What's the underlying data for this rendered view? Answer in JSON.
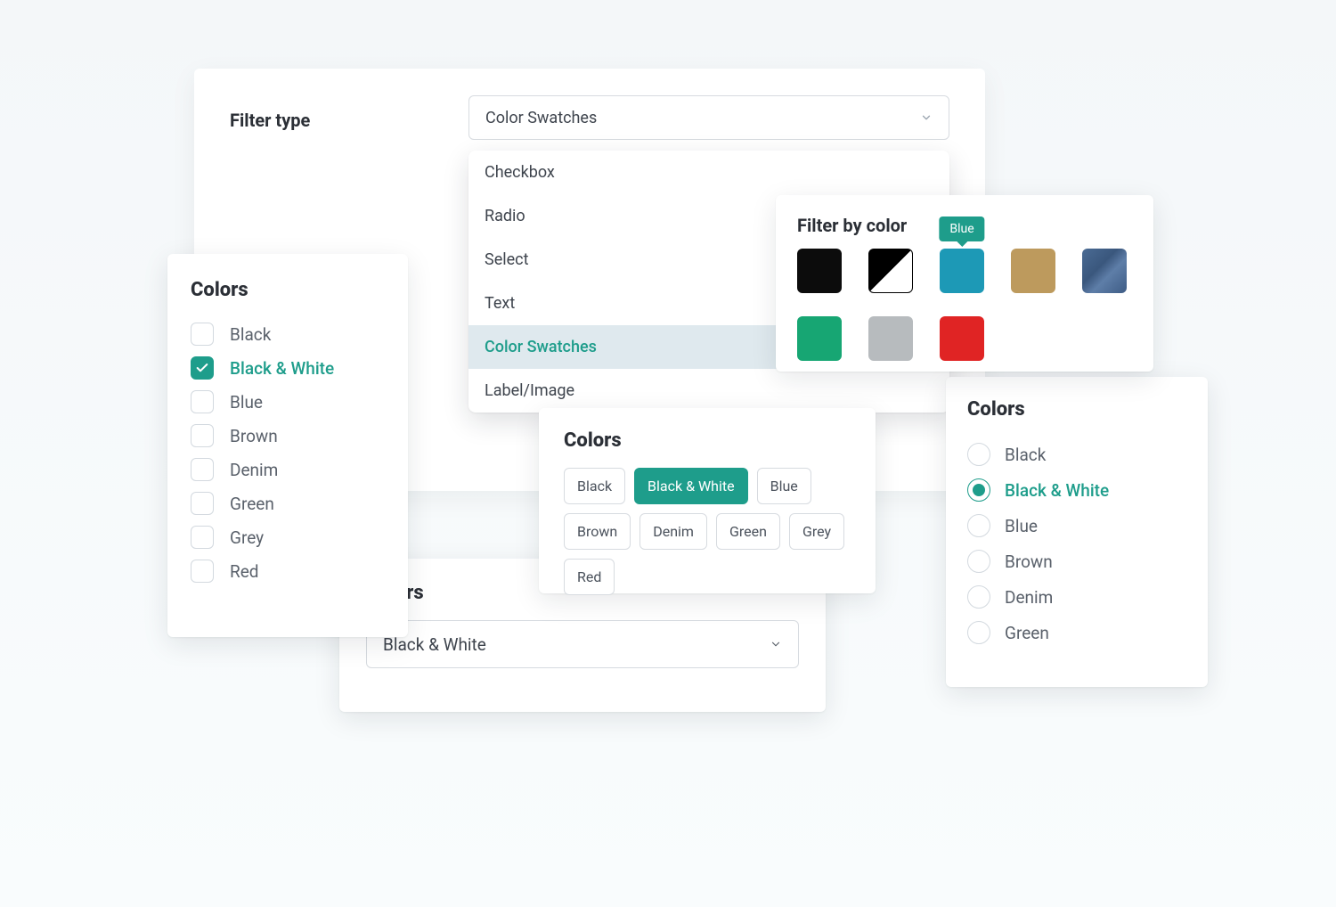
{
  "settings": {
    "label": "Filter type",
    "selected": "Color Swatches",
    "options": [
      "Checkbox",
      "Radio",
      "Select",
      "Text",
      "Color Swatches",
      "Label/Image"
    ],
    "highlighted_index": 4
  },
  "checkbox_panel": {
    "title": "Colors",
    "items": [
      {
        "label": "Black",
        "checked": false
      },
      {
        "label": "Black & White",
        "checked": true
      },
      {
        "label": "Blue",
        "checked": false
      },
      {
        "label": "Brown",
        "checked": false
      },
      {
        "label": "Denim",
        "checked": false
      },
      {
        "label": "Green",
        "checked": false
      },
      {
        "label": "Grey",
        "checked": false
      },
      {
        "label": "Red",
        "checked": false
      }
    ]
  },
  "swatch_panel": {
    "title": "Filter by color",
    "tooltip": "Blue",
    "swatches": [
      {
        "name": "Black",
        "color": "#0c0c0c",
        "row": 0,
        "tooltip": false
      },
      {
        "name": "Black & White",
        "split": true,
        "row": 0,
        "tooltip": false
      },
      {
        "name": "Blue",
        "color": "#1d99b6",
        "row": 0,
        "tooltip": true
      },
      {
        "name": "Brown",
        "color": "#bd9a5d",
        "row": 0,
        "tooltip": false
      },
      {
        "name": "Denim",
        "denim": true,
        "row": 0,
        "tooltip": false
      },
      {
        "name": "Green",
        "color": "#17a673",
        "row": 1,
        "tooltip": false
      },
      {
        "name": "Grey",
        "color": "#b7bbbe",
        "row": 1,
        "tooltip": false
      },
      {
        "name": "Red",
        "color": "#e02424",
        "row": 1,
        "tooltip": false
      }
    ]
  },
  "chips_panel": {
    "title": "Colors",
    "items": [
      {
        "label": "Black",
        "active": false
      },
      {
        "label": "Black & White",
        "active": true
      },
      {
        "label": "Blue",
        "active": false
      },
      {
        "label": "Brown",
        "active": false
      },
      {
        "label": "Denim",
        "active": false
      },
      {
        "label": "Green",
        "active": false
      },
      {
        "label": "Grey",
        "active": false
      },
      {
        "label": "Red",
        "active": false
      }
    ]
  },
  "radio_panel": {
    "title": "Colors",
    "items": [
      {
        "label": "Black",
        "checked": false
      },
      {
        "label": "Black & White",
        "checked": true
      },
      {
        "label": "Blue",
        "checked": false
      },
      {
        "label": "Brown",
        "checked": false
      },
      {
        "label": "Denim",
        "checked": false
      },
      {
        "label": "Green",
        "checked": false
      }
    ]
  },
  "select_panel": {
    "title": "Colors",
    "value": "Black & White"
  },
  "colors": {
    "accent": "#1e9d8b"
  }
}
